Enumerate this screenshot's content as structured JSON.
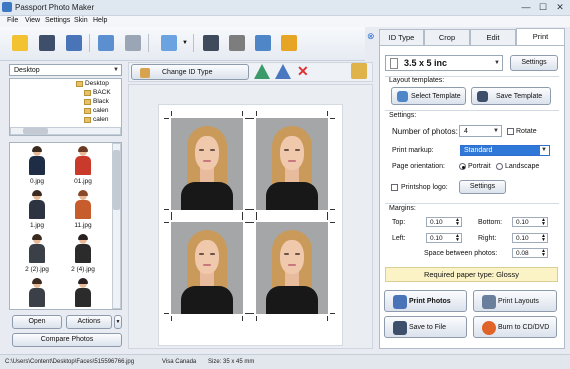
{
  "window": {
    "title": "Passport Photo Maker",
    "minimize": "—",
    "maximize": "☐",
    "close": "✕"
  },
  "menu": [
    "File",
    "View",
    "Settings",
    "Skin",
    "Help"
  ],
  "toolbar_icons": [
    "wizard-icon",
    "save-icon",
    "print-icon",
    "camera-user-icon",
    "webcam-icon",
    "screen-icon",
    "book-icon",
    "film-icon",
    "share-icon",
    "cart-icon"
  ],
  "browser": {
    "drive": "Desktop",
    "tree": [
      "Desktop",
      "BACK",
      "Black",
      "calen",
      "calen"
    ],
    "thumbs": [
      {
        "name": "0.jpg",
        "hair": "#3a2a20",
        "shirt": "#1f2c45"
      },
      {
        "name": "01.jpg",
        "hair": "#6b3a22",
        "shirt": "#c93a2b"
      },
      {
        "name": "1.jpg",
        "hair": "#3a2a20",
        "shirt": "#2d3340"
      },
      {
        "name": "11.jpg",
        "hair": "#8a4a2a",
        "shirt": "#c75c2c"
      },
      {
        "name": "2 (2).jpg",
        "hair": "#3a2a20",
        "shirt": "#3b3f48"
      },
      {
        "name": "2 (4).jpg",
        "hair": "#2a2020",
        "shirt": "#2b2b2b"
      },
      {
        "name": "",
        "hair": "#3a2a20",
        "shirt": "#3b3f48"
      },
      {
        "name": "",
        "hair": "#2a2020",
        "shirt": "#2b2b2b"
      }
    ],
    "open": "Open",
    "actions": "Actions",
    "compare": "Compare Photos"
  },
  "edit_toolbar": {
    "change_id": "Change ID Type"
  },
  "tabs": [
    "ID Type",
    "Crop",
    "Edit",
    "Print"
  ],
  "print": {
    "paper": "3.5 x 5 inc",
    "settings": "Settings",
    "layout_templates": "Layout templates:",
    "select_template": "Select Template",
    "save_template": "Save Template",
    "settings_label": "Settings:",
    "num_photos_label": "Number of photos:",
    "num_photos": "4",
    "rotate": "Rotate",
    "markup_label": "Print markup:",
    "markup": "Standard",
    "orientation_label": "Page orientation:",
    "portrait": "Portrait",
    "landscape": "Landscape",
    "logo_label": "Printshop logo:",
    "logo_settings": "Settings",
    "margins_label": "Margins:",
    "top_label": "Top:",
    "top": "0.10",
    "bottom_label": "Bottom:",
    "bottom": "0.10",
    "left_label": "Left:",
    "left": "0.10",
    "right_label": "Right:",
    "right": "0.10",
    "space_label": "Space between photos:",
    "space": "0.08",
    "required": "Required paper type: Glossy",
    "print_photos": "Print Photos",
    "print_layouts": "Print Layouts",
    "save_file": "Save to File",
    "burn": "Burn to CD/DVD"
  },
  "status": {
    "path": "C:\\Users\\Content\\Desktop\\Faces\\515596766.jpg",
    "type": "Visa Canada",
    "size": "Size: 35 x 45 mm"
  },
  "colors": {
    "accent": "#2f6fcf",
    "markup_bg": "#2f78d8",
    "required_bg": "#fbf3c6"
  }
}
